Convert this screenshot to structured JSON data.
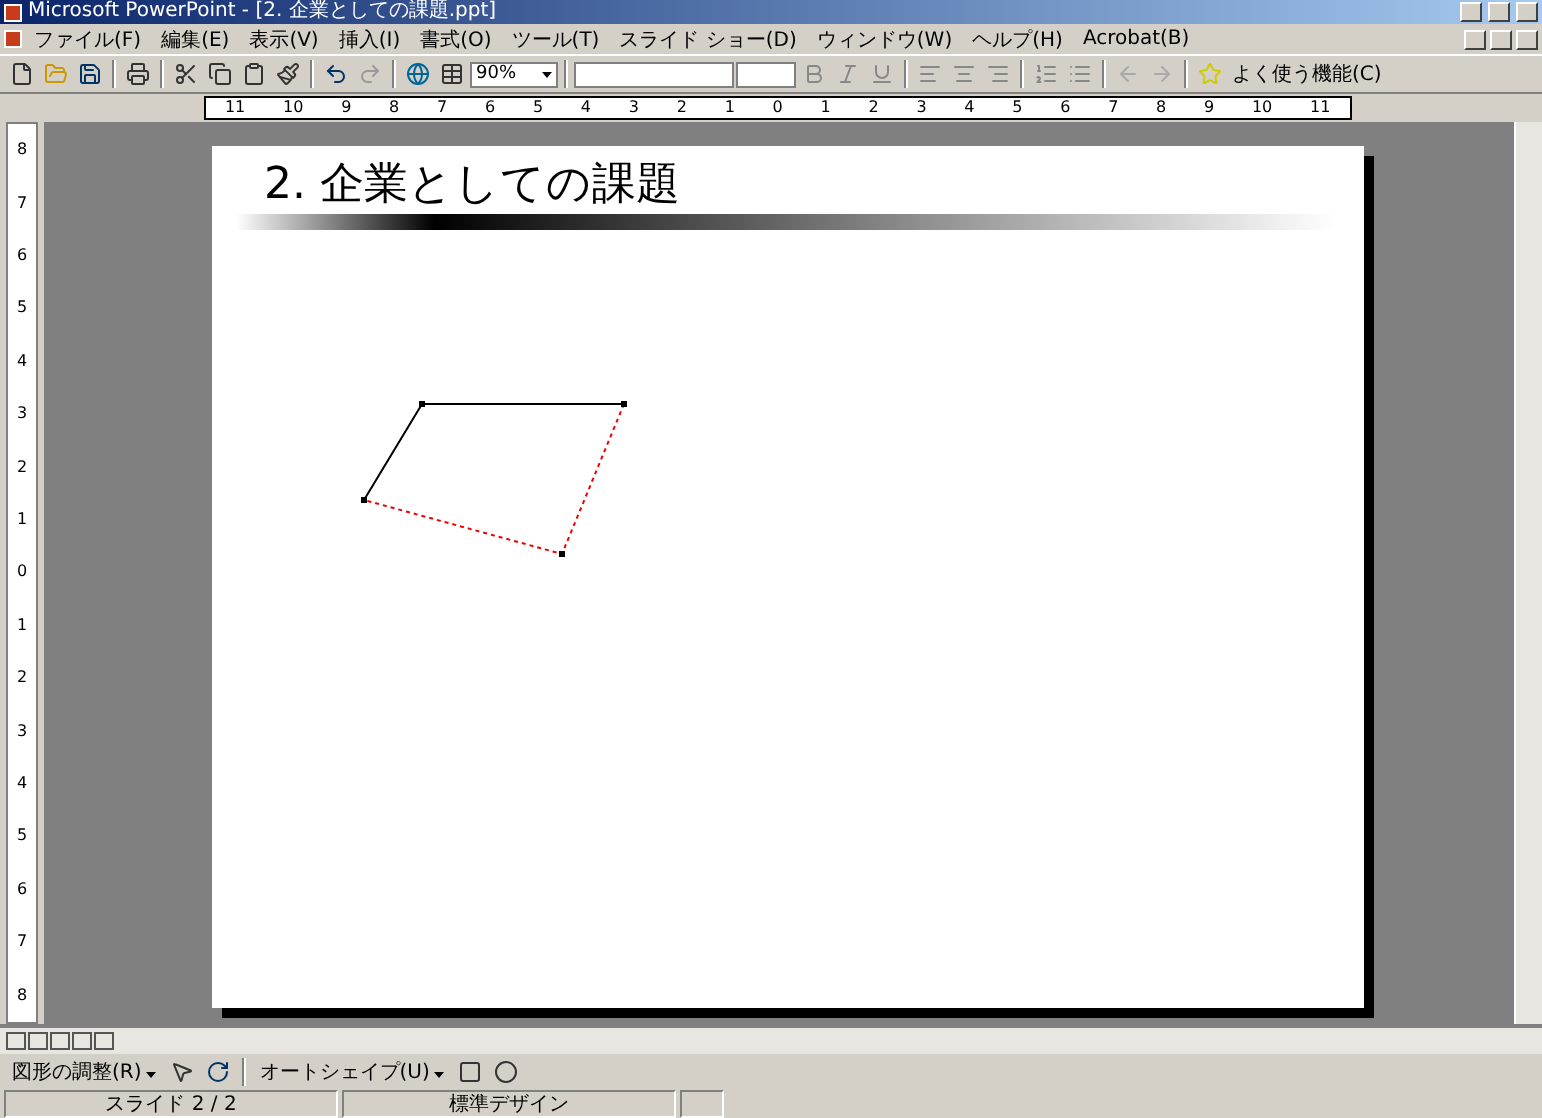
{
  "window": {
    "title": "Microsoft PowerPoint - [2. 企業としての課題.ppt]"
  },
  "menu": [
    {
      "label": "ファイル(F)"
    },
    {
      "label": "編集(E)"
    },
    {
      "label": "表示(V)"
    },
    {
      "label": "挿入(I)"
    },
    {
      "label": "書式(O)"
    },
    {
      "label": "ツール(T)"
    },
    {
      "label": "スライド ショー(D)"
    },
    {
      "label": "ウィンドウ(W)"
    },
    {
      "label": "ヘルプ(H)"
    },
    {
      "label": "Acrobat(B)"
    }
  ],
  "toolbar": {
    "zoom": "90%",
    "favorites": "よく使う機能(C)"
  },
  "ruler": {
    "horizontal": [
      "11",
      "10",
      "9",
      "8",
      "7",
      "6",
      "5",
      "4",
      "3",
      "2",
      "1",
      "0",
      "1",
      "2",
      "3",
      "4",
      "5",
      "6",
      "7",
      "8",
      "9",
      "10",
      "11"
    ],
    "vertical": [
      "8",
      "7",
      "6",
      "5",
      "4",
      "3",
      "2",
      "1",
      "0",
      "1",
      "2",
      "3",
      "4",
      "5",
      "6",
      "7",
      "8"
    ]
  },
  "slide": {
    "title": "2. 企業としての課題"
  },
  "drawing_toolbar": {
    "draw": "図形の調整(R)",
    "autoshapes": "オートシェイプ(U)"
  },
  "status_bar": {
    "slide": "スライド 2 / 2",
    "design": "標準デザイン"
  }
}
